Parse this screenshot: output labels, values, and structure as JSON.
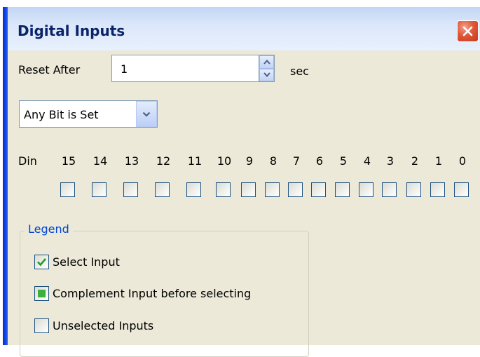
{
  "window": {
    "title": "Digital Inputs"
  },
  "reset": {
    "label": "Reset After",
    "value": "1",
    "unit": "sec"
  },
  "mode": {
    "selected": "Any Bit is Set"
  },
  "bits": {
    "row_label": "Din",
    "numbers": [
      "15",
      "14",
      "13",
      "12",
      "11",
      "10",
      "9",
      "8",
      "7",
      "6",
      "5",
      "4",
      "3",
      "2",
      "1",
      "0"
    ],
    "states": [
      "unselected",
      "unselected",
      "unselected",
      "unselected",
      "unselected",
      "unselected",
      "unselected",
      "unselected",
      "unselected",
      "unselected",
      "unselected",
      "unselected",
      "unselected",
      "unselected",
      "unselected",
      "unselected"
    ]
  },
  "legend": {
    "title": "Legend",
    "items": [
      {
        "label": "Select Input",
        "state": "checked"
      },
      {
        "label": "Complement Input before selecting",
        "state": "complement"
      },
      {
        "label": "Unselected Inputs",
        "state": "unselected"
      }
    ]
  },
  "colors": {
    "check": "#21a121",
    "complement_fill": "#3fb03f",
    "legend_title": "#0046d5",
    "close_button": "#e0573a"
  }
}
